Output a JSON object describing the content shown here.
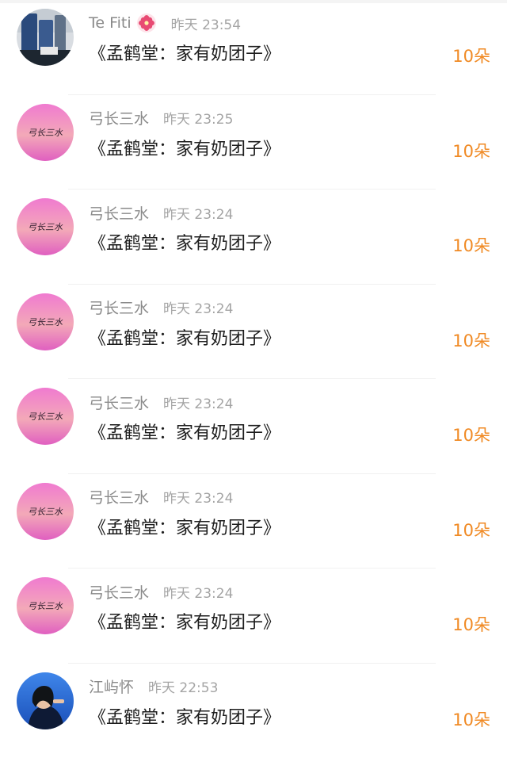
{
  "entries": [
    {
      "user": "Te Fiti",
      "badge": "flower-icon",
      "time": "昨天 23:54",
      "gift": "《孟鹤堂：家有奶团子》",
      "count": "10朵",
      "avatar": "photo-avatar"
    },
    {
      "user": "弓长三水",
      "time": "昨天 23:25",
      "gift": "《孟鹤堂：家有奶团子》",
      "count": "10朵",
      "avatar": "pink-glitter-avatar"
    },
    {
      "user": "弓长三水",
      "time": "昨天 23:24",
      "gift": "《孟鹤堂：家有奶团子》",
      "count": "10朵",
      "avatar": "pink-glitter-avatar"
    },
    {
      "user": "弓长三水",
      "time": "昨天 23:24",
      "gift": "《孟鹤堂：家有奶团子》",
      "count": "10朵",
      "avatar": "pink-glitter-avatar"
    },
    {
      "user": "弓长三水",
      "time": "昨天 23:24",
      "gift": "《孟鹤堂：家有奶团子》",
      "count": "10朵",
      "avatar": "pink-glitter-avatar"
    },
    {
      "user": "弓长三水",
      "time": "昨天 23:24",
      "gift": "《孟鹤堂：家有奶团子》",
      "count": "10朵",
      "avatar": "pink-glitter-avatar"
    },
    {
      "user": "弓长三水",
      "time": "昨天 23:24",
      "gift": "《孟鹤堂：家有奶团子》",
      "count": "10朵",
      "avatar": "pink-glitter-avatar"
    },
    {
      "user": "江屿怀",
      "time": "昨天 22:53",
      "gift": "《孟鹤堂：家有奶团子》",
      "count": "10朵",
      "avatar": "portrait-avatar"
    }
  ],
  "colors": {
    "accent": "#f08a24",
    "username": "#8a8a8a",
    "time": "#a4a4a4",
    "text": "#1e1e1e"
  }
}
